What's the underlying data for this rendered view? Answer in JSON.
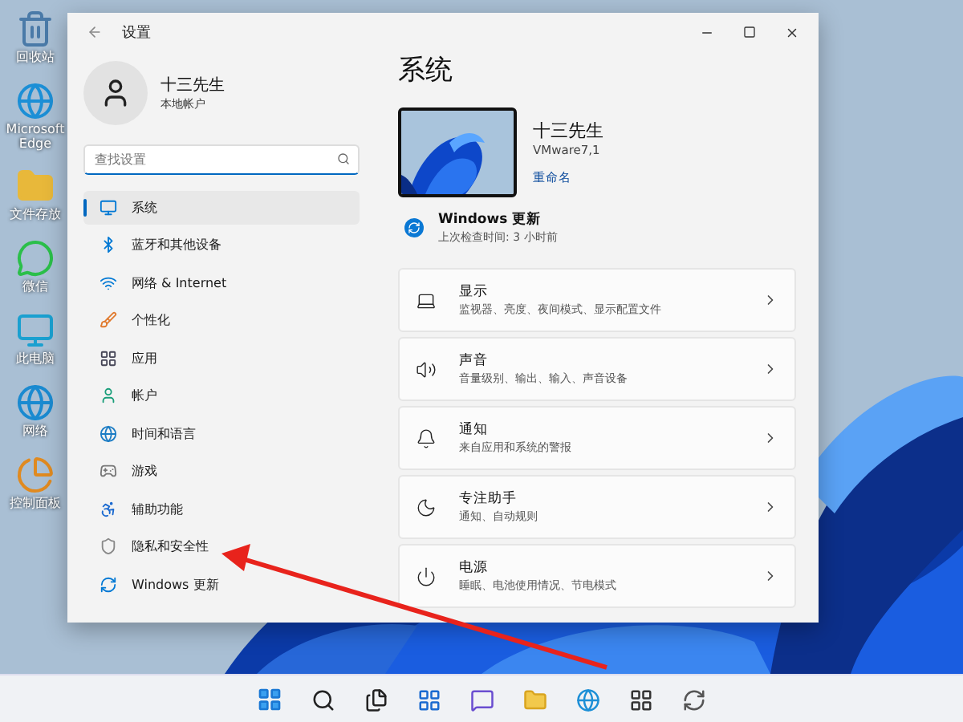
{
  "desktop_icons": [
    {
      "label": "回收站"
    },
    {
      "label": "Microsoft Edge"
    },
    {
      "label": "文件存放"
    },
    {
      "label": "微信"
    },
    {
      "label": "此电脑"
    },
    {
      "label": "网络"
    },
    {
      "label": "控制面板"
    }
  ],
  "window": {
    "title": "设置",
    "user": {
      "name": "十三先生",
      "account": "本地帐户"
    },
    "search": {
      "placeholder": "查找设置"
    },
    "nav": [
      {
        "label": "系统",
        "selected": true
      },
      {
        "label": "蓝牙和其他设备",
        "selected": false
      },
      {
        "label": "网络 & Internet",
        "selected": false
      },
      {
        "label": "个性化",
        "selected": false
      },
      {
        "label": "应用",
        "selected": false
      },
      {
        "label": "帐户",
        "selected": false
      },
      {
        "label": "时间和语言",
        "selected": false
      },
      {
        "label": "游戏",
        "selected": false
      },
      {
        "label": "辅助功能",
        "selected": false
      },
      {
        "label": "隐私和安全性",
        "selected": false
      },
      {
        "label": "Windows 更新",
        "selected": false
      }
    ],
    "page_title": "系统",
    "device": {
      "name": "十三先生",
      "model": "VMware7,1",
      "rename_link": "重命名"
    },
    "update": {
      "title": "Windows 更新",
      "subtitle": "上次检查时间: 3 小时前"
    },
    "cards": [
      {
        "title": "显示",
        "subtitle": "监视器、亮度、夜间模式、显示配置文件"
      },
      {
        "title": "声音",
        "subtitle": "音量级别、输出、输入、声音设备"
      },
      {
        "title": "通知",
        "subtitle": "来自应用和系统的警报"
      },
      {
        "title": "专注助手",
        "subtitle": "通知、自动规则"
      },
      {
        "title": "电源",
        "subtitle": "睡眠、电池使用情况、节电模式"
      }
    ]
  }
}
